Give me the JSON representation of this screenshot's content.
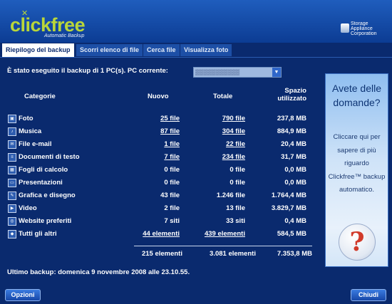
{
  "header": {
    "logo": "clickfree",
    "tagline": "Automatic Backup",
    "vendor_line1": "Storage",
    "vendor_line2": "Appliance",
    "vendor_line3": "Corporation"
  },
  "tabs": [
    {
      "label": "Riepilogo del backup",
      "active": true
    },
    {
      "label": "Scorri elenco di file",
      "active": false
    },
    {
      "label": "Cerca file",
      "active": false
    },
    {
      "label": "Visualizza foto",
      "active": false
    }
  ],
  "pc_line": "È stato eseguito il backup di 1 PC(s). PC corrente:",
  "pc_selected": "▒▒▒▒▒▒▒▒▒▒▒",
  "columns": {
    "category": "Categorie",
    "new": "Nuovo",
    "total": "Totale",
    "space": "Spazio utilizzato"
  },
  "rows": [
    {
      "category": "Foto",
      "icon": "photo-icon",
      "new": "25 file",
      "total": "790 file",
      "space": "237,8 MB",
      "new_link": true,
      "total_link": true
    },
    {
      "category": "Musica",
      "icon": "music-icon",
      "new": "87 file",
      "total": "304 file",
      "space": "884,9 MB",
      "new_link": true,
      "total_link": true
    },
    {
      "category": "File e-mail",
      "icon": "email-icon",
      "new": "1 file",
      "total": "22 file",
      "space": "20,4 MB",
      "new_link": true,
      "total_link": true
    },
    {
      "category": "Documenti di testo",
      "icon": "document-icon",
      "new": "7 file",
      "total": "234 file",
      "space": "31,7 MB",
      "new_link": true,
      "total_link": true
    },
    {
      "category": "Fogli di calcolo",
      "icon": "spreadsheet-icon",
      "new": "0 file",
      "total": "0 file",
      "space": "0,0 MB",
      "new_link": false,
      "total_link": false
    },
    {
      "category": "Presentazioni",
      "icon": "presentation-icon",
      "new": "0 file",
      "total": "0 file",
      "space": "0,0 MB",
      "new_link": false,
      "total_link": false
    },
    {
      "category": "Grafica e disegno",
      "icon": "graphics-icon",
      "new": "43 file",
      "total": "1.246 file",
      "space": "1.764,4 MB",
      "new_link": false,
      "total_link": false
    },
    {
      "category": "Video",
      "icon": "video-icon",
      "new": "2 file",
      "total": "13 file",
      "space": "3.829,7 MB",
      "new_link": false,
      "total_link": false
    },
    {
      "category": "Website preferiti",
      "icon": "website-icon",
      "new": "7 siti",
      "total": "33 siti",
      "space": "0,4 MB",
      "new_link": false,
      "total_link": false
    },
    {
      "category": "Tutti gli altri",
      "icon": "other-files-icon",
      "new": "44 elementi",
      "total": "439 elementi",
      "space": "584,5 MB",
      "new_link": true,
      "total_link": true
    }
  ],
  "totals": {
    "new": "215 elementi",
    "total": "3.081 elementi",
    "space": "7.353,8 MB"
  },
  "last_backup": "Ultimo backup: domenica 9 novembre 2008 alle 23.10.55.",
  "help": {
    "title": "Avete delle domande?",
    "body": "Cliccare qui per sapere di più riguardo Clickfree™ backup automatico.",
    "qmark": "?"
  },
  "footer": {
    "options": "Opzioni",
    "close": "Chiudi"
  }
}
